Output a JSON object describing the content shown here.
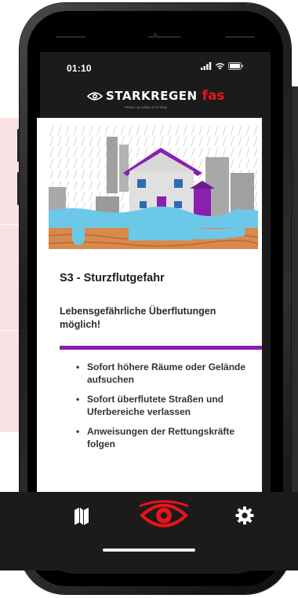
{
  "status_bar": {
    "time": "01:10",
    "icons": [
      "signal-icon",
      "wifi-icon",
      "battery-icon"
    ]
  },
  "app_header": {
    "logo_icon": "eye-icon",
    "brand": "STARKREGEN",
    "suffix": "fas",
    "tagline": "FRÜH-ALARM-SYSTEM"
  },
  "warning": {
    "illustration": "flooded-house-illustration",
    "title": "S3 - Sturzflutgefahr",
    "subtitle": "Lebensgefährliche Überflutungen möglich!",
    "instructions": [
      "Sofort höhere Räume oder Gelände aufsuchen",
      "Sofort überflutete Straßen und Uferbereiche verlassen",
      "Anweisungen der Rettungskräfte folgen"
    ]
  },
  "bottom_nav": {
    "items": [
      {
        "icon": "map-icon"
      },
      {
        "icon": "eye-icon",
        "active": true
      },
      {
        "icon": "gear-icon"
      }
    ]
  },
  "colors": {
    "accent": "#8b1fae",
    "brand_red": "#e8131b",
    "app_bar": "#1b1b1b",
    "flood_water": "#6cc8e8",
    "soil": "#d88a4c"
  }
}
